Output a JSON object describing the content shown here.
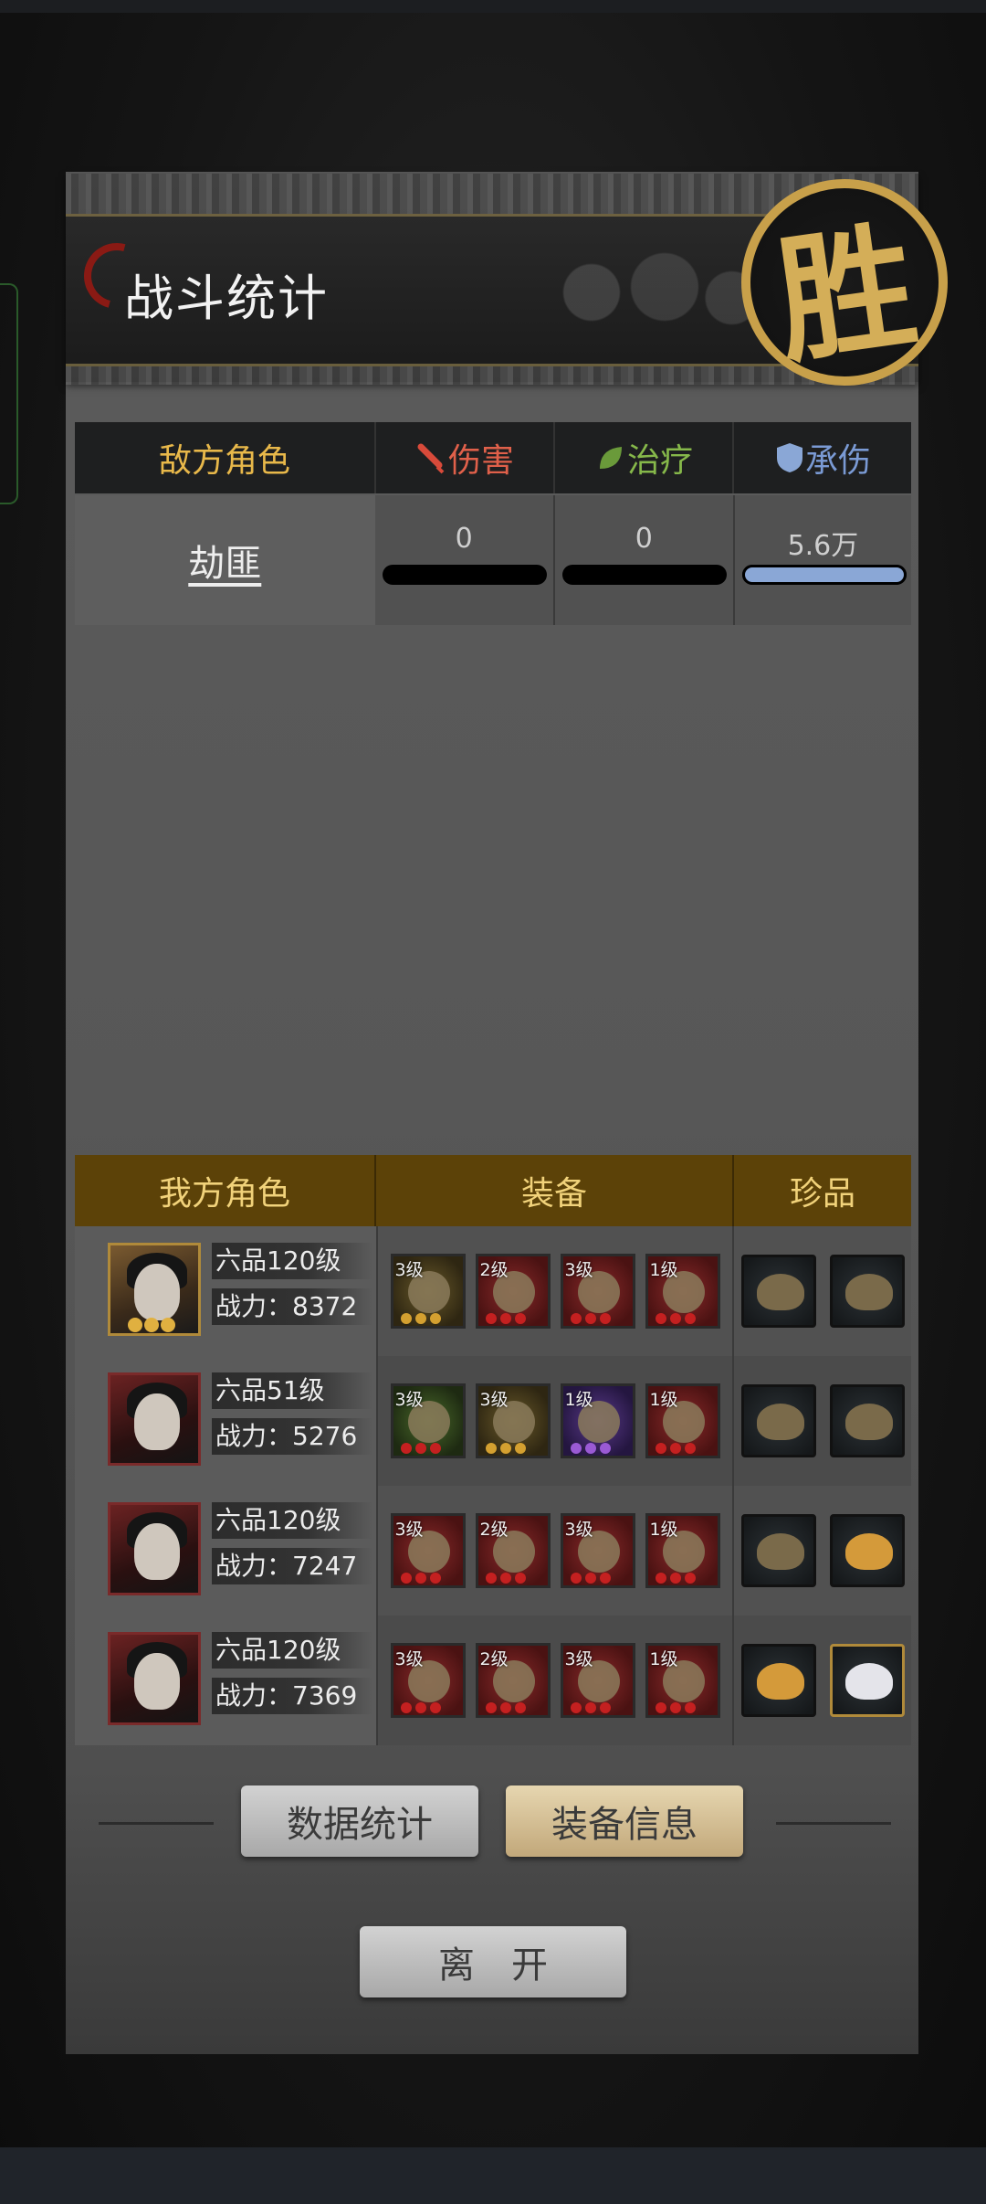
{
  "header": {
    "title": "战斗统计",
    "result_seal": "胜"
  },
  "enemy_table": {
    "columns": [
      "敌方角色",
      "伤害",
      "治疗",
      "承伤"
    ],
    "column_colors": [
      "#e8b84a",
      "#e0604a",
      "#86b84a",
      "#7a9ad4"
    ],
    "rows": [
      {
        "name": "劫匪",
        "damage": "0",
        "heal": "0",
        "taken": "5.6万",
        "damage_fraction": 0,
        "heal_fraction": 0,
        "taken_fraction": 1
      }
    ]
  },
  "ally_table": {
    "columns": [
      "我方角色",
      "装备",
      "珍品"
    ],
    "rows": [
      {
        "rank_level": "六品120级",
        "power": "战力：8372",
        "equips": [
          "3级",
          "2级",
          "3级",
          "1级"
        ],
        "treasures": [
          "feather-treasure-icon",
          "feather-treasure-icon"
        ]
      },
      {
        "rank_level": "六品51级",
        "power": "战力：5276",
        "equips": [
          "3级",
          "3级",
          "1级",
          "1级"
        ],
        "treasures": [
          "mushroom-treasure-icon",
          "comb-treasure-icon"
        ]
      },
      {
        "rank_level": "六品120级",
        "power": "战力：7247",
        "equips": [
          "3级",
          "2级",
          "3级",
          "1级"
        ],
        "treasures": [
          "mushroom-treasure-icon",
          "gold-fan-treasure-icon"
        ]
      },
      {
        "rank_level": "六品120级",
        "power": "战力：7369",
        "equips": [
          "3级",
          "2级",
          "3级",
          "1级"
        ],
        "treasures": [
          "gold-fan-treasure-icon",
          "jade-rabbit-treasure-icon"
        ]
      }
    ]
  },
  "buttons": {
    "stats": "数据统计",
    "equip_info": "装备信息",
    "leave": "离　开"
  }
}
